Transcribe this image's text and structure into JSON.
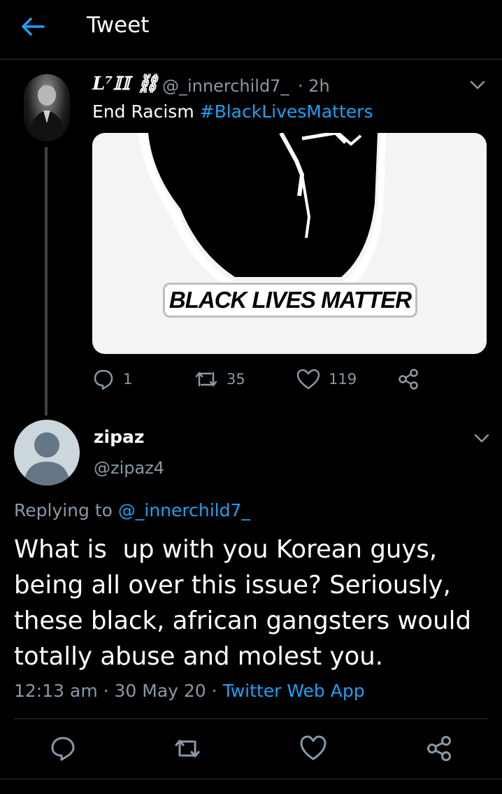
{
  "header": {
    "title": "Tweet",
    "back_icon": "arrow-left-icon"
  },
  "colors": {
    "accent": "#1da1f2",
    "muted": "#8899a6",
    "background": "#000000"
  },
  "parent_tweet": {
    "display_name": "L⁷𝕀𝕀 ⛓",
    "handle": "@_innerchild7_",
    "time": "· 2h",
    "text": "End Racism ",
    "hashtag": "#BlackLivesMatters",
    "image_text": "BLACK LIVES MATTER",
    "replies": "1",
    "retweets": "35",
    "likes": "119"
  },
  "reply": {
    "display_name": "zipaz",
    "handle": "@zipaz4",
    "replying_prefix": "Replying to ",
    "replying_to": "@_innerchild7_",
    "text": "What is  up with you Korean guys,\nbeing all over this issue? Seriously,\nthese black, african gangsters would\ntotally abuse and molest you.",
    "time": "12:13 am · 30 May 20 · ",
    "source": "Twitter Web App"
  }
}
